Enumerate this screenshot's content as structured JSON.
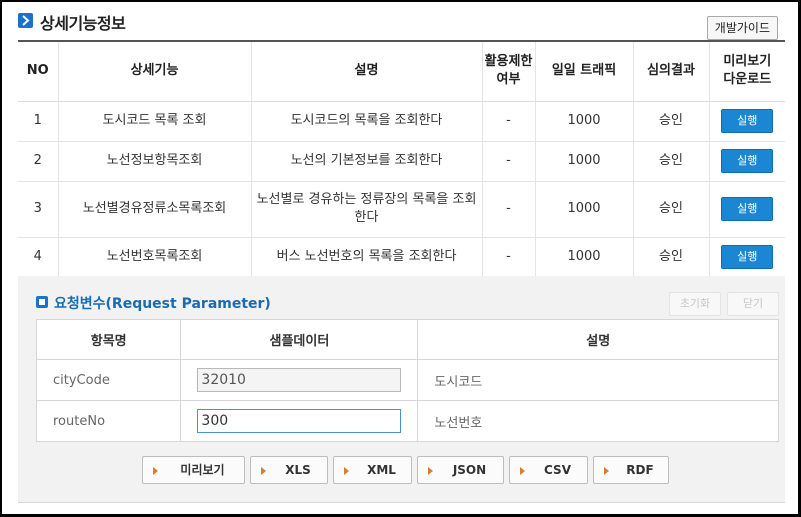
{
  "header": {
    "title": "상세기능정보",
    "dev_guide_label": "개발가이드"
  },
  "table": {
    "columns": {
      "no": "NO",
      "feature": "상세기능",
      "desc": "설명",
      "limit": "활용제한 여부",
      "traffic": "일일 트래픽",
      "review": "심의결과",
      "preview": "미리보기 다운로드"
    },
    "rows": [
      {
        "no": "1",
        "feature": "도시코드 목록 조회",
        "desc": "도시코드의 목록을 조회한다",
        "limit": "-",
        "traffic": "1000",
        "review": "승인",
        "button": "실행"
      },
      {
        "no": "2",
        "feature": "노선정보항목조회",
        "desc": "노선의 기본정보를 조회한다",
        "limit": "-",
        "traffic": "1000",
        "review": "승인",
        "button": "실행"
      },
      {
        "no": "3",
        "feature": "노선별경유정류소목록조회",
        "desc": "노선별로 경유하는 정류장의 목록을 조회한다",
        "limit": "-",
        "traffic": "1000",
        "review": "승인",
        "button": "실행"
      },
      {
        "no": "4",
        "feature": "노선번호목록조회",
        "desc": "버스 노선번호의 목록을 조회한다",
        "limit": "-",
        "traffic": "1000",
        "review": "승인",
        "button": "실행"
      }
    ]
  },
  "params": {
    "title": "요청변수(Request Parameter)",
    "reset_label": "초기화",
    "close_label": "닫기",
    "columns": {
      "name": "항목명",
      "sample": "샘플데이터",
      "desc": "설명"
    },
    "rows": [
      {
        "name": "cityCode",
        "value": "32010",
        "desc": "도시코드"
      },
      {
        "name": "routeNo",
        "value": "300",
        "desc": "노선번호"
      }
    ]
  },
  "downloads": {
    "preview": "미리보기",
    "xls": "XLS",
    "xml": "XML",
    "json": "JSON",
    "csv": "CSV",
    "rdf": "RDF"
  },
  "colors": {
    "accent": "#1a73c8",
    "run_button": "#1b86d2",
    "arrow": "#e07a2c"
  }
}
